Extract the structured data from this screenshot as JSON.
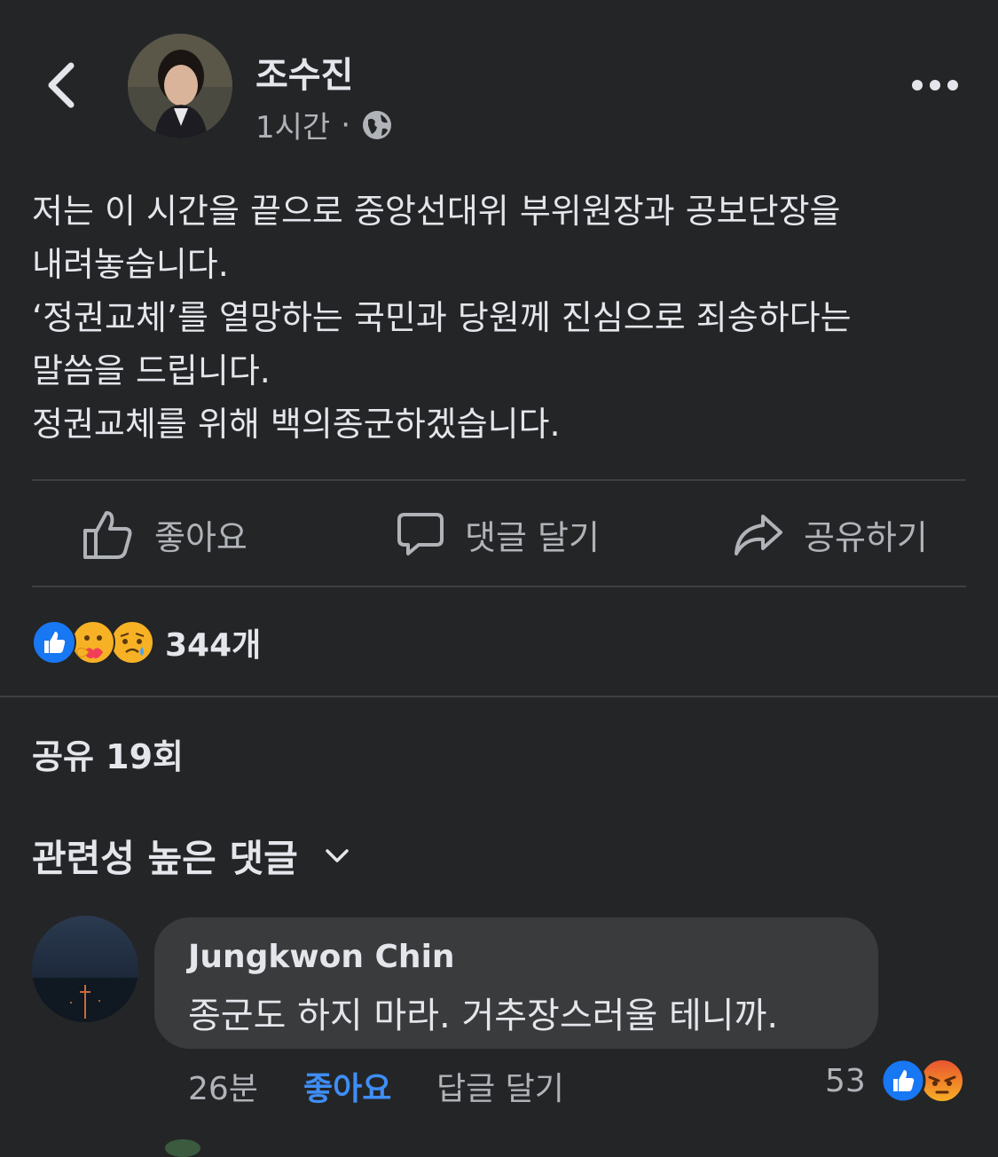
{
  "header": {
    "author_name": "조수진",
    "time": "1시간",
    "separator": "·",
    "privacy_icon": "globe-icon",
    "back_icon": "chevron-left-icon",
    "more_icon": "more-horizontal-icon"
  },
  "post": {
    "lines": [
      "저는 이 시간을 끝으로 중앙선대위 부위원장과 공보단장을",
      "내려놓습니다.",
      "‘정권교체’를 열망하는 국민과 당원께 진심으로 죄송하다는",
      "말씀을 드립니다.",
      "정권교체를 위해 백의종군하겠습니다."
    ]
  },
  "actions": {
    "like": {
      "label": "좋아요",
      "icon": "thumbs-up-icon"
    },
    "comment": {
      "label": "댓글 달기",
      "icon": "comment-icon"
    },
    "share": {
      "label": "공유하기",
      "icon": "share-icon"
    }
  },
  "reactions": {
    "icons": [
      "like-reaction-icon",
      "care-reaction-icon",
      "sad-reaction-icon"
    ],
    "count": "344개"
  },
  "shares": "공유 19회",
  "comments_filter": {
    "label": "관련성 높은 댓글",
    "icon": "chevron-down-icon"
  },
  "comment": {
    "author": "Jungkwon Chin",
    "text": "종군도 하지 마라. 거추장스러울 테니까.",
    "time": "26분",
    "like_label": "좋아요",
    "reply_label": "답글 달기",
    "reaction_count": "53",
    "reaction_icons": [
      "like-reaction-icon",
      "angry-reaction-icon"
    ]
  },
  "colors": {
    "background": "#242527",
    "text": "#e4e6eb",
    "secondary_text": "#b0b3b8",
    "link_blue": "#3f8ef7",
    "bubble": "#3a3b3c",
    "divider": "#3e4042"
  }
}
